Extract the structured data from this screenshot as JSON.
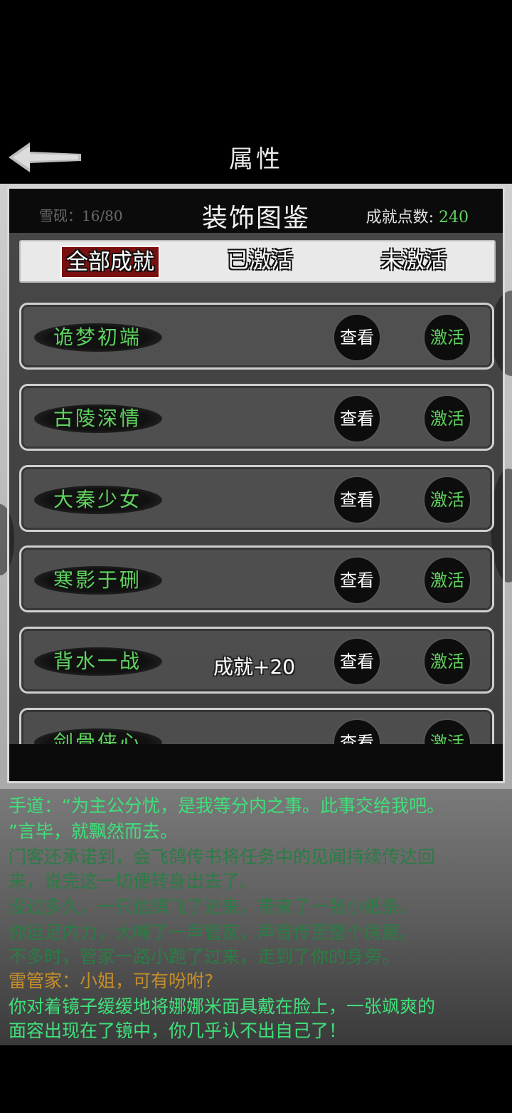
{
  "header": {
    "title": "属性"
  },
  "dialog": {
    "title": "装饰图鉴",
    "ghost_count": "雪砚：16/80",
    "points_label": "成就点数:",
    "points_value": "240",
    "tabs": [
      "全部成就",
      "已激活",
      "未激活"
    ],
    "rows": [
      {
        "name": "诡梦初端",
        "badge": "",
        "view": "查看",
        "activate": "激活"
      },
      {
        "name": "古陵深情",
        "badge": "",
        "view": "查看",
        "activate": "激活"
      },
      {
        "name": "大秦少女",
        "badge": "",
        "view": "查看",
        "activate": "激活"
      },
      {
        "name": "寒影于硎",
        "badge": "",
        "view": "查看",
        "activate": "激活"
      },
      {
        "name": "背水一战",
        "badge": "成就+20",
        "view": "查看",
        "activate": "激活"
      },
      {
        "name": "剑骨侠心",
        "badge": "",
        "view": "查看",
        "activate": "激活"
      }
    ]
  },
  "story": [
    {
      "text": "手道：“为主公分忧，是我等分内之事。此事交给我吧。",
      "style": "bright"
    },
    {
      "text": "”言毕，就飘然而去。",
      "style": "bright"
    },
    {
      "text": "门客还承诺到，会飞鸽传书将任务中的见闻持续传达回",
      "style": "dim"
    },
    {
      "text": "来，说完这一切便转身出去了。",
      "style": "dim"
    },
    {
      "text": "没过多久，一只信鸽飞了进来，带来了一张小纸条。",
      "style": "dim"
    },
    {
      "text": "你运足内力，大喊了一声管家，声音传至整个房屋。",
      "style": "dim"
    },
    {
      "text": "不多时，管家一路小跑了过来，走到了你的身旁。",
      "style": "dim"
    },
    {
      "text": "雷管家：小姐，可有吩咐?",
      "style": "speaker"
    },
    {
      "text": "你对着镜子缓缓地将娜娜米面具戴在脸上，一张飒爽的",
      "style": "bright"
    },
    {
      "text": "面容出现在了镜中，你几乎认不出自己了！",
      "style": "bright"
    }
  ]
}
